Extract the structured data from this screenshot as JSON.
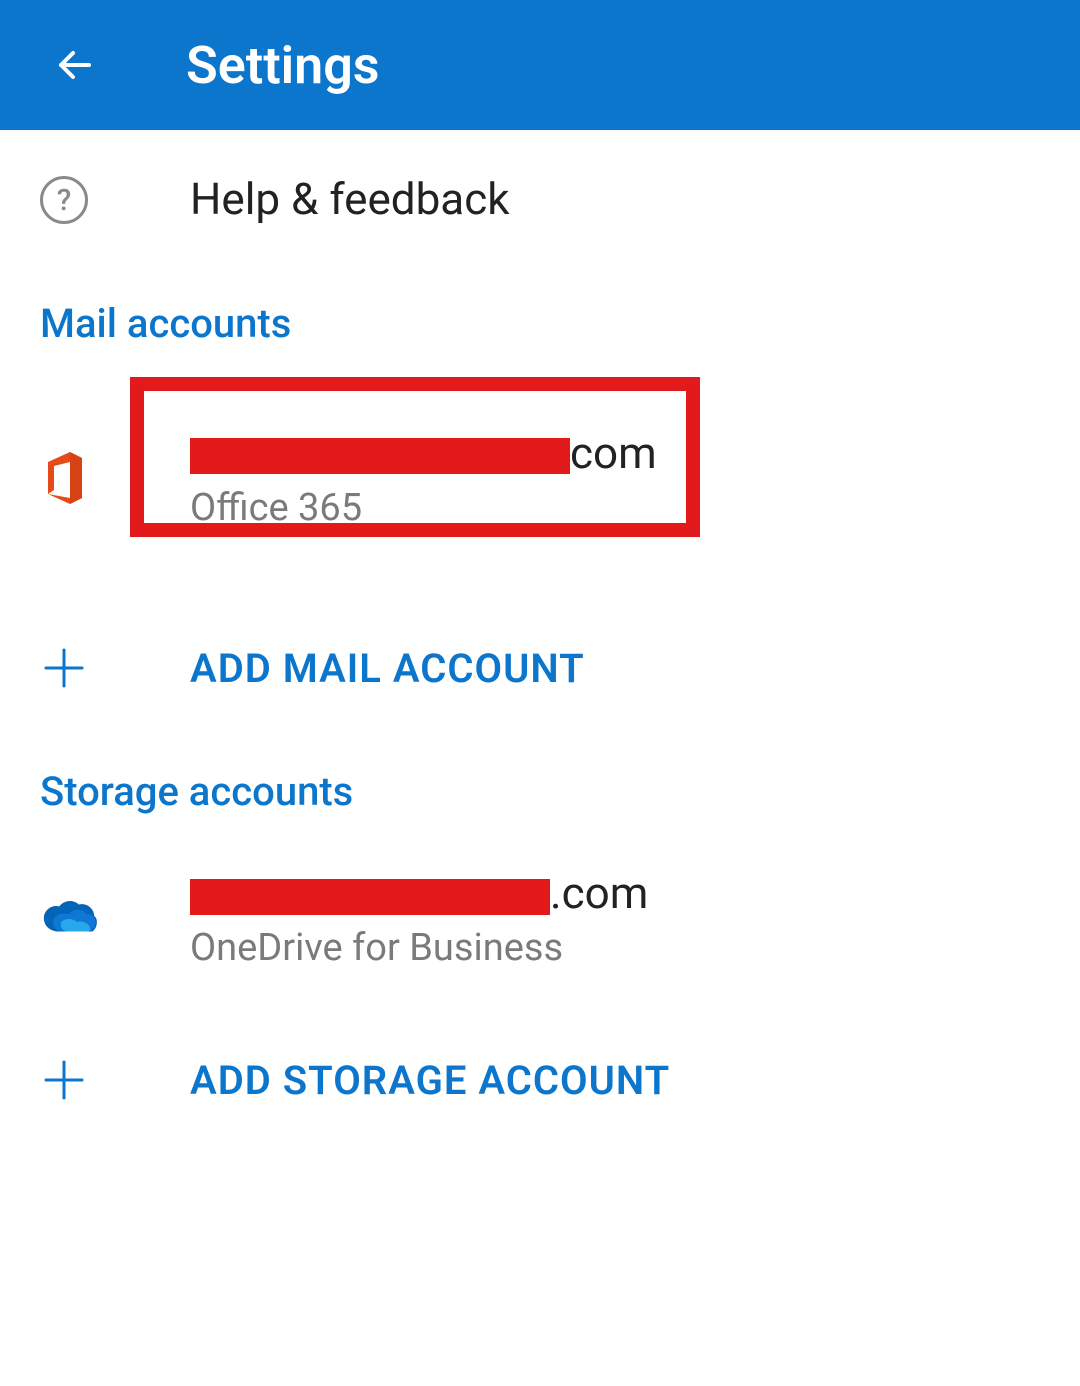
{
  "header": {
    "title": "Settings"
  },
  "help": {
    "label": "Help & feedback"
  },
  "sections": {
    "mail": {
      "header": "Mail accounts",
      "account": {
        "email_visible_suffix": "com",
        "type": "Office 365"
      },
      "add_label": "ADD MAIL ACCOUNT"
    },
    "storage": {
      "header": "Storage accounts",
      "account": {
        "email_visible_suffix": ".com",
        "type": "OneDrive for Business"
      },
      "add_label": "ADD STORAGE ACCOUNT"
    }
  },
  "icons": {
    "back": "arrow-left",
    "help": "question-circle",
    "office": "office-logo",
    "onedrive": "onedrive-cloud",
    "plus": "plus"
  }
}
